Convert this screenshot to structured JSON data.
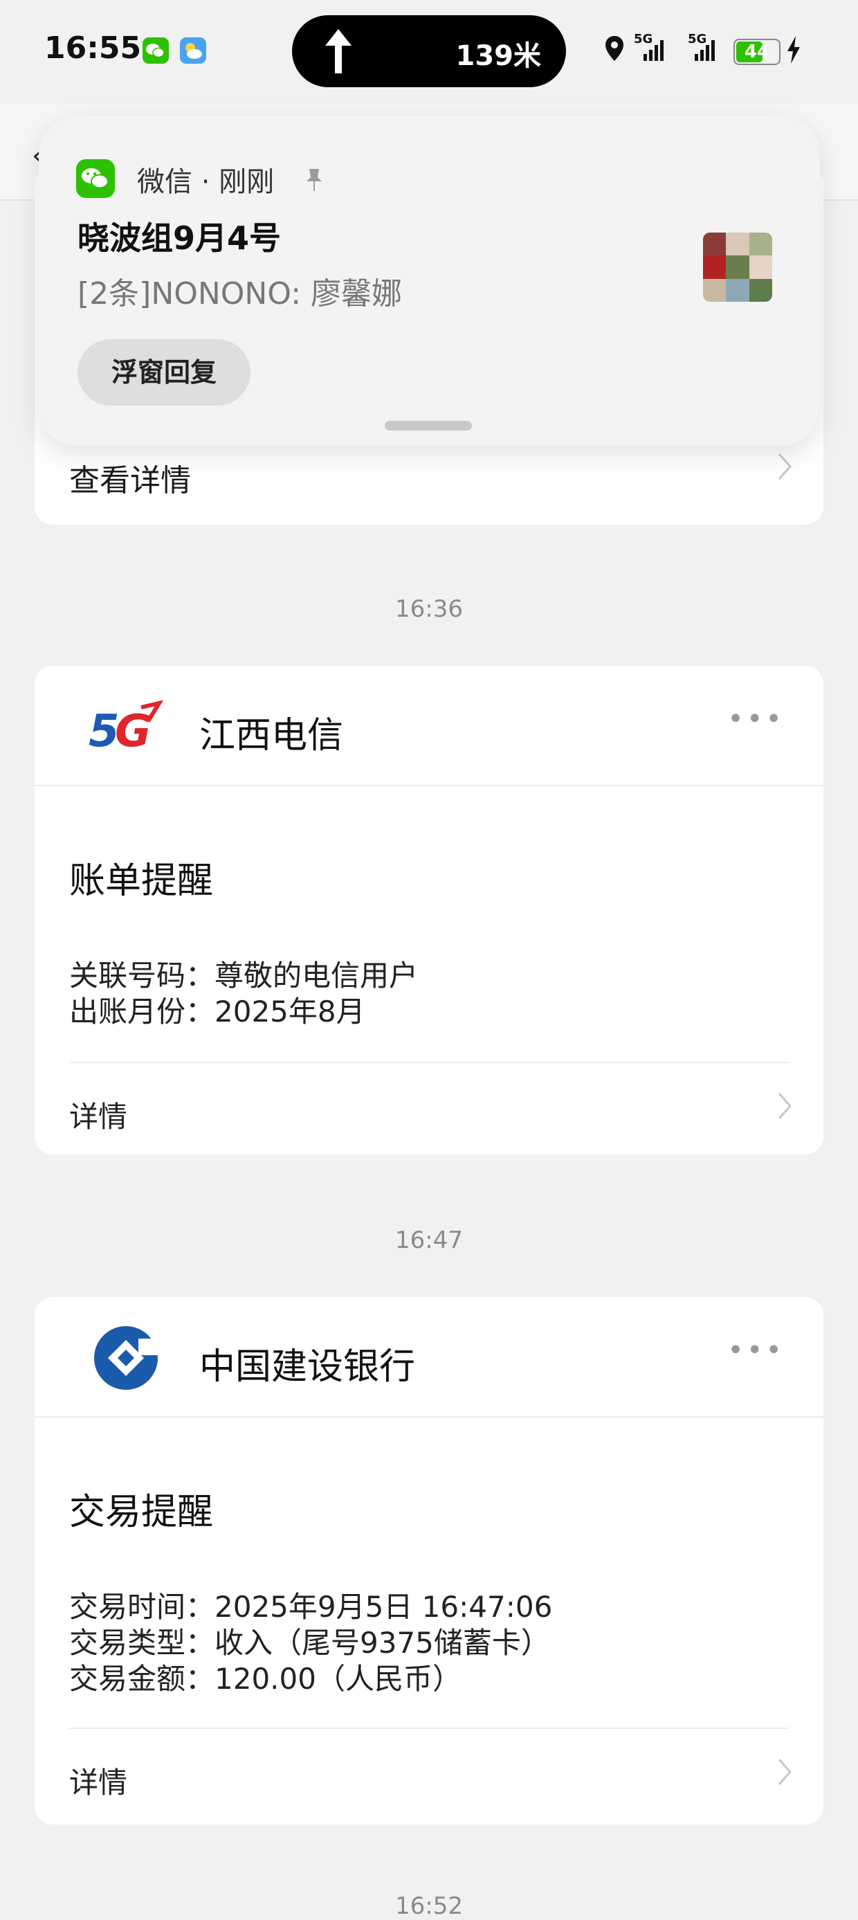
{
  "status_bar": {
    "time": "16:55",
    "island_text": "139米",
    "battery": "44",
    "network_1": "5G",
    "network_2": "5G"
  },
  "notification": {
    "app": "微信 · 刚刚",
    "title": "晓波组9月4号",
    "message": "[2条]NONONO: 廖馨娜",
    "reply_label": "浮窗回复"
  },
  "prev_card": {
    "row_label": "查看详情"
  },
  "messages": [
    {
      "time": "16:36",
      "sender": "江西电信",
      "logo_text": "5G",
      "section_title": "账单提醒",
      "fields": [
        "关联号码：尊敬的电信用户",
        "出账月份：2025年8月"
      ],
      "detail_label": "详情"
    },
    {
      "time": "16:47",
      "sender": "中国建设银行",
      "section_title": "交易提醒",
      "fields": [
        "交易时间：2025年9月5日 16:47:06",
        "交易类型：收入（尾号9375储蓄卡）",
        "交易金额：120.00（人民币）"
      ],
      "detail_label": "详情"
    },
    {
      "time": "16:52"
    }
  ],
  "colors": {
    "wechat_green": "#2dc100",
    "telecom_blue": "#1e5ab4",
    "telecom_red": "#e0252b",
    "ccb_blue": "#1b5bab",
    "background": "#f1f1f1"
  }
}
